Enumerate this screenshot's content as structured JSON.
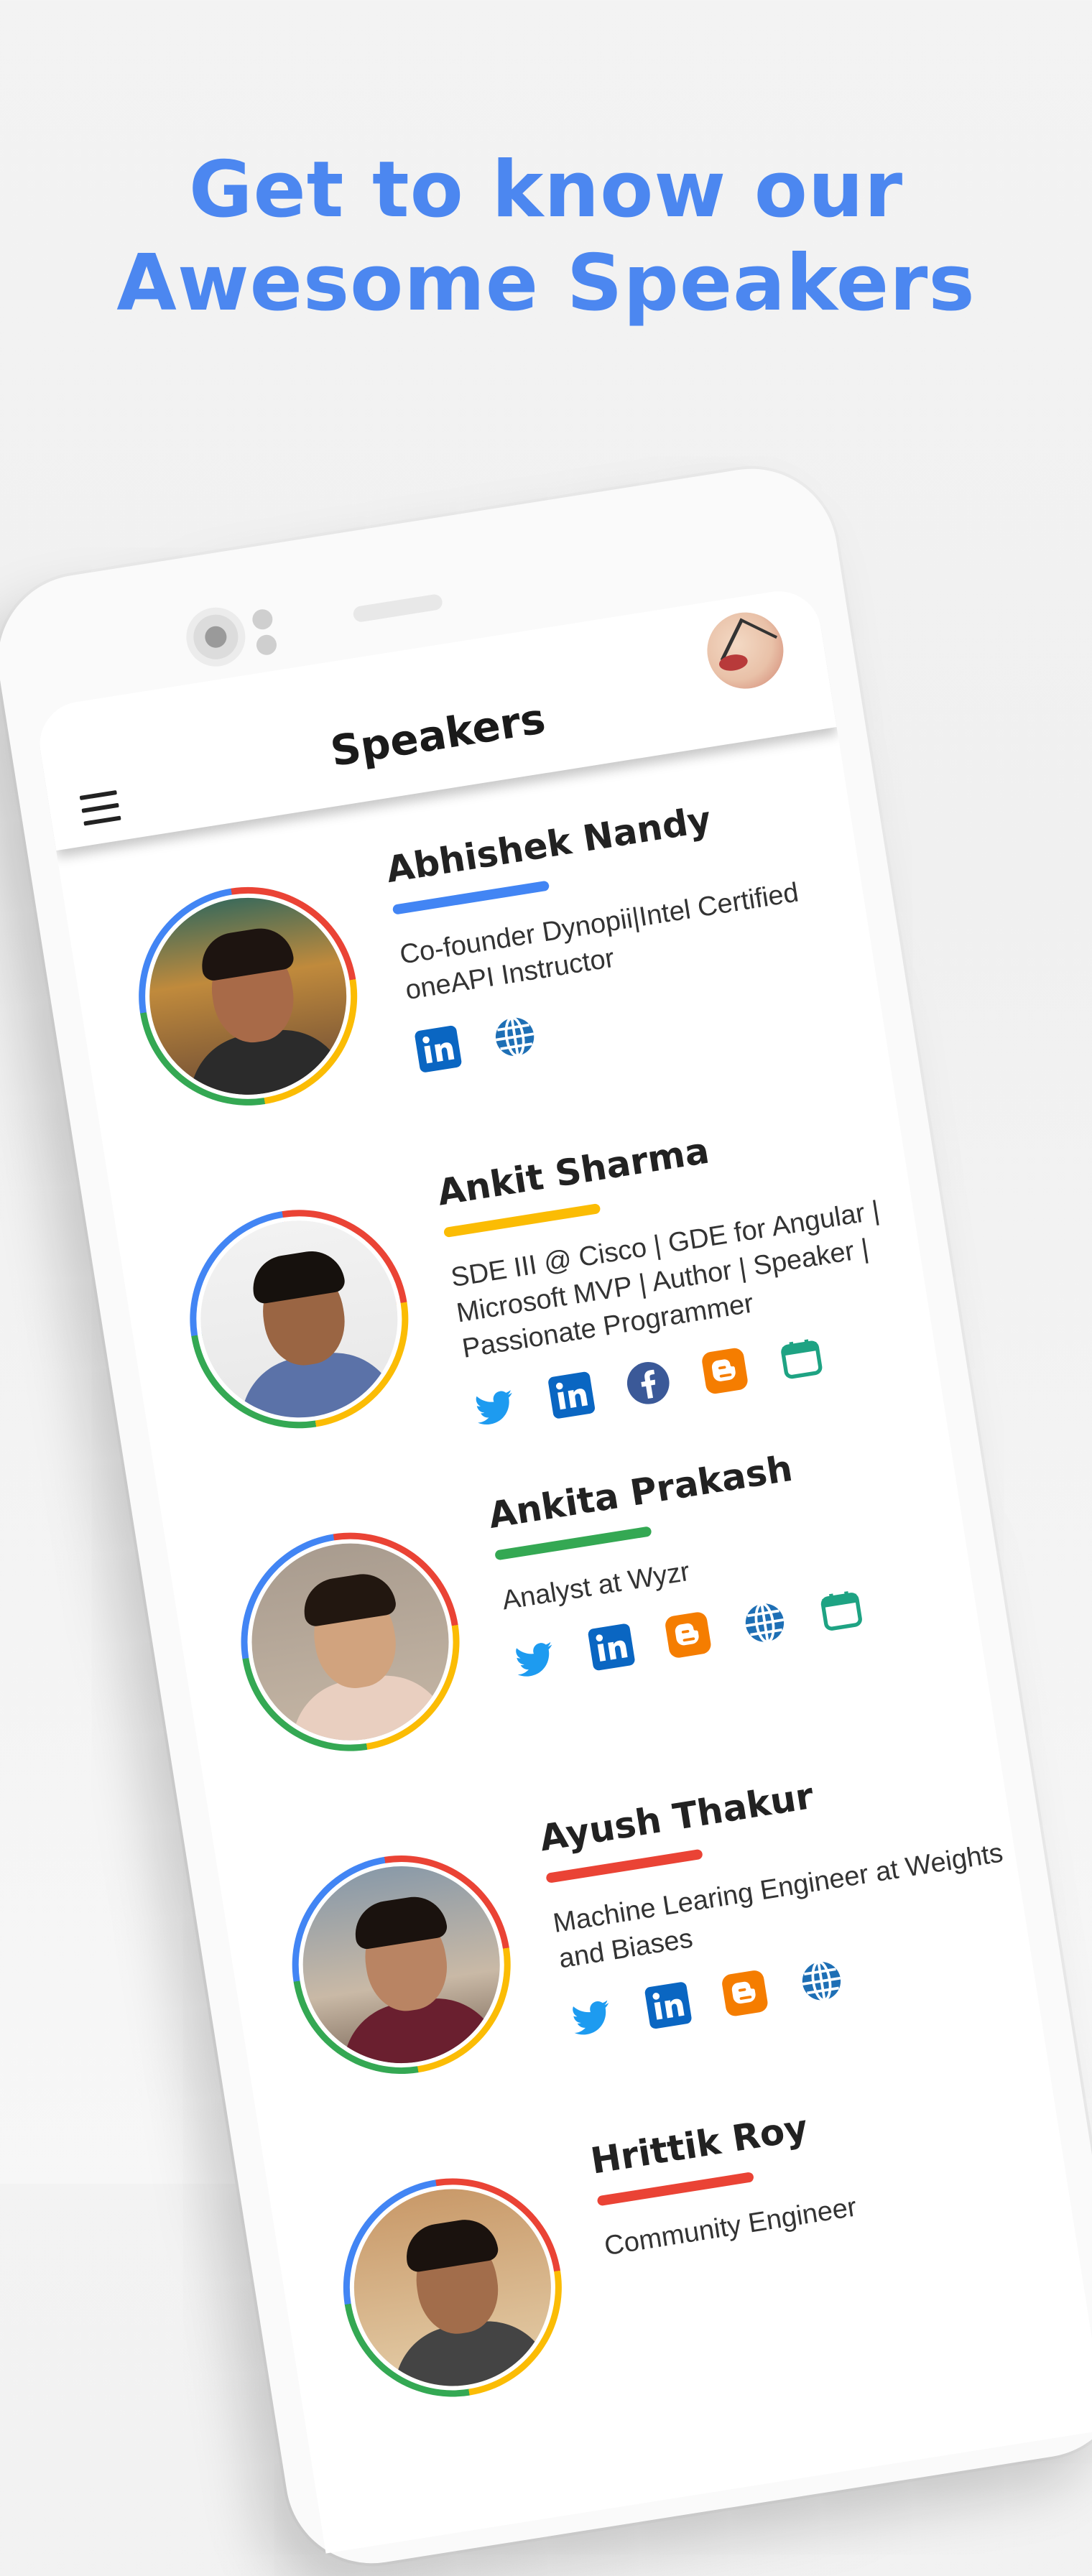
{
  "hero": {
    "line1": "Get to know our",
    "line2": "Awesome Speakers"
  },
  "app": {
    "title": "Speakers",
    "menu_icon": "hamburger-menu-icon",
    "avatar_icon": "profile-avatar"
  },
  "colors": {
    "hero_text": "#4c87f0",
    "blue": "#4285f4",
    "yellow": "#fbbc04",
    "green": "#34a853",
    "red": "#ea4335"
  },
  "speakers": [
    {
      "name": "Abhishek Nandy",
      "bio": "Co-founder Dynopii|Intel Certified oneAPI Instructor",
      "accent": "#4285f4",
      "socials": [
        "linkedin",
        "website"
      ]
    },
    {
      "name": "Ankit Sharma",
      "bio": "SDE III @ Cisco | GDE for Angular | Microsoft MVP | Author | Speaker | Passionate Programmer",
      "accent": "#fbbc04",
      "socials": [
        "twitter",
        "linkedin",
        "facebook",
        "blogger",
        "sessionize"
      ]
    },
    {
      "name": "Ankita Prakash",
      "bio": "Analyst at Wyzr",
      "accent": "#34a853",
      "socials": [
        "twitter",
        "linkedin",
        "blogger",
        "website",
        "sessionize"
      ]
    },
    {
      "name": "Ayush Thakur",
      "bio": "Machine Learing Engineer at Weights and Biases",
      "accent": "#ea4335",
      "socials": [
        "twitter",
        "linkedin",
        "blogger",
        "website"
      ]
    },
    {
      "name": "Hrittik Roy",
      "bio": "Community Engineer",
      "accent": "#ea4335",
      "socials": []
    }
  ]
}
